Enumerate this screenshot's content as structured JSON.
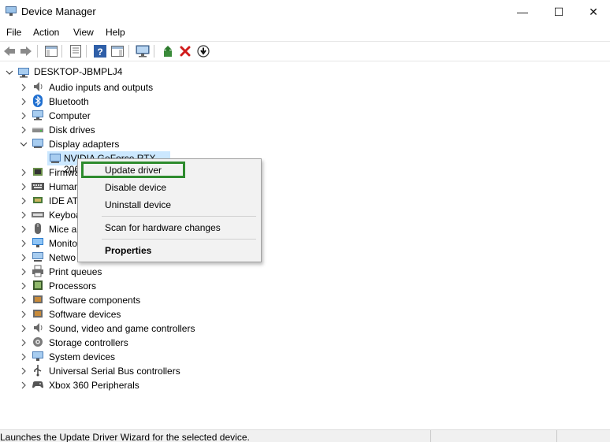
{
  "window": {
    "title": "Device Manager",
    "minimize_glyph": "—",
    "maximize_glyph": "☐",
    "close_glyph": "✕"
  },
  "menu": {
    "items": [
      "File",
      "Action",
      "View",
      "Help"
    ]
  },
  "toolbar": {
    "icons": [
      "back-arrow-icon",
      "forward-arrow-icon",
      "show-hide-console-tree-icon",
      "properties-icon",
      "help-icon",
      "action-pane-icon",
      "scan-hardware-icon",
      "update-driver-icon",
      "uninstall-icon",
      "download-icon"
    ]
  },
  "tree": {
    "root": "DESKTOP-JBMPLJ4",
    "categories": [
      "Audio inputs and outputs",
      "Bluetooth",
      "Computer",
      "Disk drives",
      "Display adapters",
      "Firmwa",
      "Human",
      "IDE ATA",
      "Keyboa",
      "Mice a",
      "Monito",
      "Netwo",
      "Print queues",
      "Processors",
      "Software components",
      "Software devices",
      "Sound, video and game controllers",
      "Storage controllers",
      "System devices",
      "Universal Serial Bus controllers",
      "Xbox 360 Peripherals"
    ],
    "selected_device": "NVIDIA GeForce RTX 2060"
  },
  "context_menu": {
    "items": [
      "Update driver",
      "Disable device",
      "Uninstall device",
      "Scan for hardware changes",
      "Properties"
    ]
  },
  "status": {
    "text": "Launches the Update Driver Wizard for the selected device."
  },
  "colors": {
    "highlight": "#2e8b2e",
    "selection": "#cce8ff",
    "menu_bg": "#f2f2f2"
  }
}
